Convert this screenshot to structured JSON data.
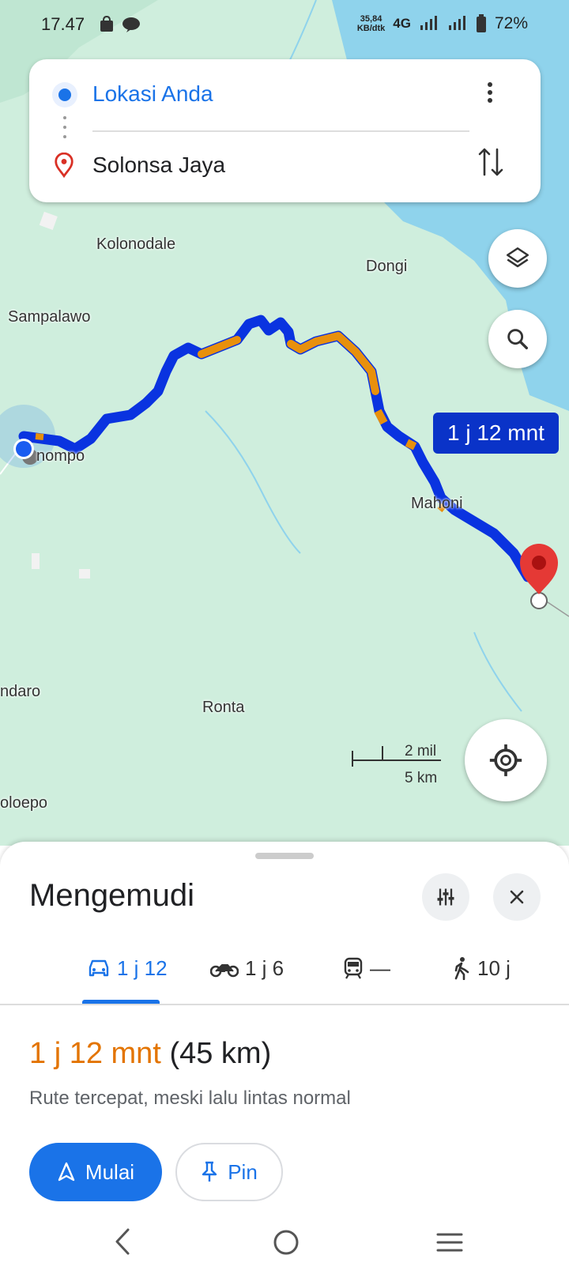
{
  "status_bar": {
    "time": "17.47",
    "net_speed_value": "35,84",
    "net_speed_unit": "KB/dtk",
    "network": "4G",
    "battery": "72%"
  },
  "directions": {
    "origin": "Lokasi Anda",
    "destination": "Solonsa Jaya"
  },
  "map": {
    "labels": {
      "kolonodale": "Kolonodale",
      "dongi": "Dongi",
      "sampalawo": "Sampalawo",
      "nompo": "nompo",
      "mahoni": "Mahoni",
      "ndaro": "ndaro",
      "ronta": "Ronta",
      "oloepo": "oloepo"
    },
    "eta_badge": "1 j 12 mnt",
    "scale_imperial": "2 mil",
    "scale_metric": "5 km",
    "colors": {
      "route": "#0a33e0",
      "traffic": "#e8900c",
      "water": "#8fd3ec",
      "land": "#cfeedd"
    }
  },
  "sheet": {
    "title": "Mengemudi",
    "modes": [
      {
        "icon": "car-icon",
        "label": "1 j 12"
      },
      {
        "icon": "motorcycle-icon",
        "label": "1 j 6"
      },
      {
        "icon": "train-icon",
        "label": "—"
      },
      {
        "icon": "walk-icon",
        "label": "10 j"
      }
    ],
    "duration": "1 j 12 mnt",
    "distance": "(45 km)",
    "description": "Rute tercepat, meski lalu lintas normal",
    "start_label": "Mulai",
    "pin_label": "Pin"
  }
}
